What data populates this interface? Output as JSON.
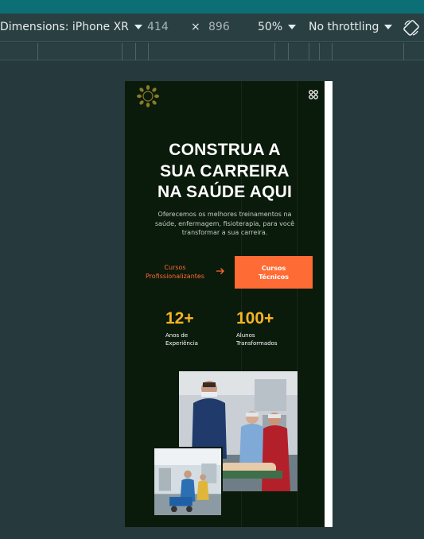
{
  "devtools": {
    "dimensions_label": "Dimensions: iPhone XR",
    "width_value": "414",
    "times_symbol": "×",
    "height_value": "896",
    "zoom": "50%",
    "throttling": "No throttling",
    "icons": [
      "chevron-down-icon",
      "rotate-icon"
    ]
  },
  "site": {
    "logo_icon": "leaf-wreath-logo-icon",
    "menu_icon": "grid-menu-icon",
    "hero": {
      "title_line1": "CONSTRUA A",
      "title_line2": "SUA CARREIRA",
      "title_line3": "NA SAÚDE AQUI",
      "subtitle_line1": "Oferecemos os melhores treinamentos na",
      "subtitle_line2": "saúde, enfermagem, fisioterapia, para você",
      "subtitle_line3": "transformar a sua carreira."
    },
    "cta": {
      "link_line1": "Cursos",
      "link_line2": "Profissionalizantes",
      "arrow_icon": "arrow-right-icon",
      "button_line1": "Cursos",
      "button_line2": "Técnicos"
    },
    "stats": [
      {
        "number": "12+",
        "label_line1": "Anos de",
        "label_line2": "Experiência"
      },
      {
        "number": "100+",
        "label_line1": "Alunos",
        "label_line2": "Transformados"
      }
    ],
    "colors": {
      "accent": "#ff6b35",
      "stat": "#f5b323",
      "background": "#0a1a0b",
      "devtools_bg": "#263a3d"
    }
  }
}
